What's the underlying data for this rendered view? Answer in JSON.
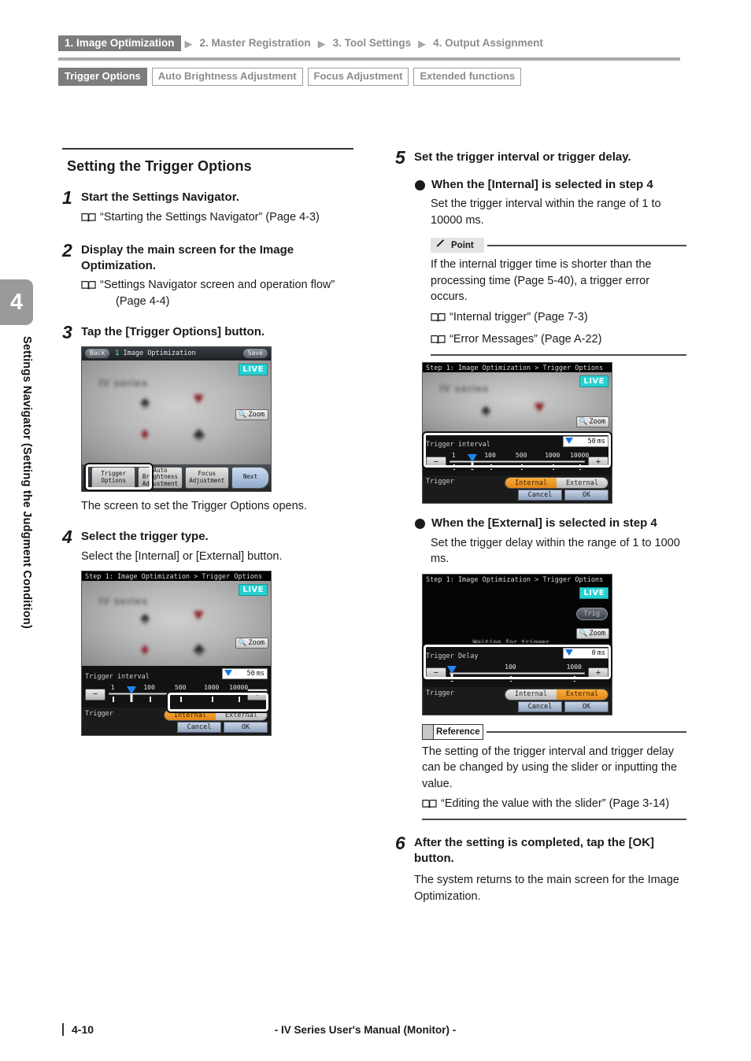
{
  "sidebar": {
    "chapter_number": "4",
    "chapter_title": "Settings Navigator (Setting the Judgment Condition)"
  },
  "header": {
    "flow": [
      {
        "label": "1. Image Optimization",
        "current": true
      },
      {
        "label": "2. Master Registration",
        "current": false
      },
      {
        "label": "3. Tool Settings",
        "current": false
      },
      {
        "label": "4. Output Assignment",
        "current": false
      }
    ],
    "tabs": [
      {
        "label": "Trigger Options",
        "current": true
      },
      {
        "label": "Auto Brightness Adjustment",
        "current": false
      },
      {
        "label": "Focus Adjustment",
        "current": false
      },
      {
        "label": "Extended functions",
        "current": false
      }
    ]
  },
  "section": {
    "title": "Setting the Trigger Options"
  },
  "steps": {
    "s1": {
      "num": "1",
      "head": "Start the Settings Navigator.",
      "xref": "“Starting the Settings Navigator” (Page 4-3)"
    },
    "s2": {
      "num": "2",
      "head": "Display the main screen for the Image Optimization.",
      "xref": "“Settings Navigator screen and operation flow”",
      "xref_cont": "(Page 4-4)"
    },
    "s3": {
      "num": "3",
      "head": "Tap the [Trigger Options] button.",
      "after": "The screen to set the Trigger Options opens."
    },
    "s4": {
      "num": "4",
      "head": "Select the trigger type.",
      "sub": "Select the [Internal] or [External] button."
    },
    "s5": {
      "num": "5",
      "head": "Set the trigger interval or trigger delay.",
      "bullet_internal": "When the [Internal] is selected in step 4",
      "internal_text": "Set the trigger interval within the range of 1 to 10000 ms.",
      "bullet_external": "When the [External] is selected in step 4",
      "external_text": "Set the trigger delay within the range of 1 to 1000 ms."
    },
    "s6": {
      "num": "6",
      "head": "After the setting is completed, tap the [OK] button.",
      "after": "The system returns to the main screen for the Image Optimization."
    }
  },
  "notes": {
    "point": {
      "badge": "Point",
      "body": "If the internal trigger time is shorter than the processing time (Page 5-40), a trigger error occurs.",
      "xref1": "“Internal trigger” (Page 7-3)",
      "xref2": "“Error Messages” (Page A-22)"
    },
    "reference": {
      "badge": "Reference",
      "body": "The setting of the trigger interval and trigger delay can be changed by using the slider or inputting the value.",
      "xref1": "“Editing the value with the slider” (Page 3-14)"
    }
  },
  "device_main": {
    "back_label": "Back",
    "title": "Image Optimization",
    "step_marker": "1",
    "save_label": "Save",
    "live_label": "LIVE",
    "zoom_label": "Zoom",
    "toolbar": [
      {
        "label": "Trigger\nOptions",
        "highlighted": true
      },
      {
        "label": "Auto\nBrightness\nAdjustment",
        "highlighted": false
      },
      {
        "label": "Focus\nAdjustment",
        "highlighted": false
      }
    ],
    "next_label": "Next"
  },
  "device_internal": {
    "breadcrumb": "Step 1: Image Optimization > Trigger Options",
    "live_label": "LIVE",
    "zoom_label": "Zoom",
    "slider_label": "Trigger interval",
    "value": "50",
    "unit": "ms",
    "minus": "−",
    "plus": "+",
    "ticks": [
      "1",
      "100",
      "500",
      "1000",
      "10000"
    ],
    "trigger_label": "Trigger",
    "seg_internal": "Internal",
    "seg_external": "External",
    "selected": "Internal",
    "cancel_label": "Cancel",
    "ok_label": "OK"
  },
  "device_external": {
    "breadcrumb": "Step 1: Image Optimization > Trigger Options",
    "live_label": "LIVE",
    "trig_label": "Trig",
    "zoom_label": "Zoom",
    "waiting_text": "Waiting for trigger...",
    "slider_label": "Trigger Delay",
    "value": "0",
    "unit": "ms",
    "minus": "−",
    "plus": "+",
    "ticks": [
      "100",
      "1000"
    ],
    "trigger_label": "Trigger",
    "seg_internal": "Internal",
    "seg_external": "External",
    "selected": "External",
    "cancel_label": "Cancel",
    "ok_label": "OK"
  },
  "footer": {
    "page_number": "4-10",
    "text": "- IV Series User's Manual (Monitor) -"
  },
  "colors": {
    "accent_orange": "#e2861a",
    "live_cyan": "#28d1d1",
    "tab_gray": "#7d7d7d",
    "slider_blue": "#1f86f0"
  }
}
